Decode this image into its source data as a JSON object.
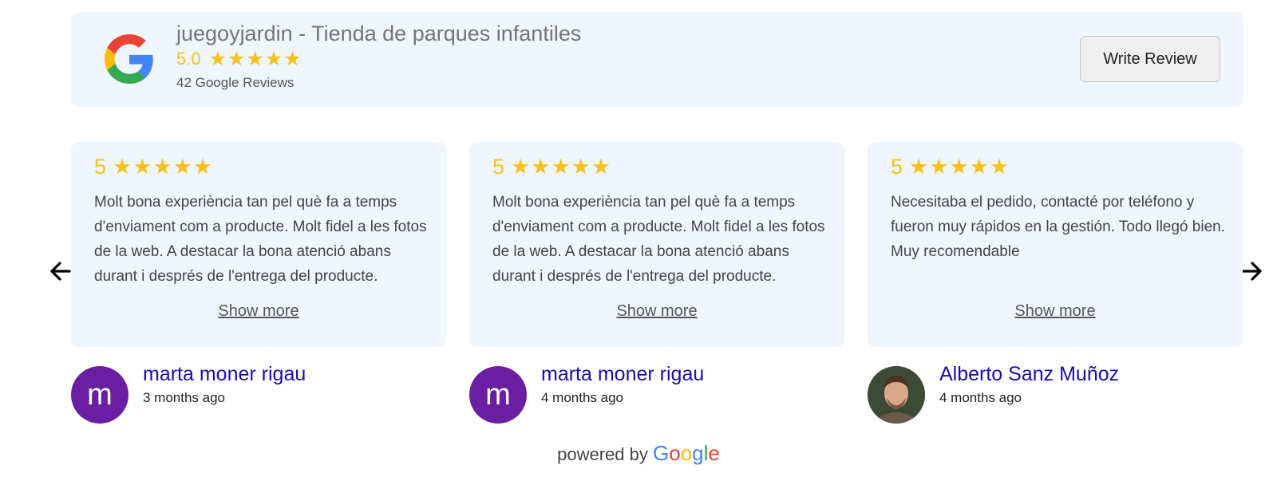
{
  "header": {
    "business_name": "juegoyjardin - Tienda de parques infantiles",
    "rating": "5.0",
    "stars": "★★★★★",
    "review_count": "42 Google Reviews",
    "write_review_label": "Write Review"
  },
  "reviews": [
    {
      "rating": "5",
      "stars": "★★★★★",
      "text": "Molt bona experiència tan pel què fa a temps d'enviament com a producte. Molt fidel a les fotos de la web. A destacar la bona atenció abans durant i després de l'entrega del producte.",
      "show_more": "Show more",
      "author": "marta moner rigau",
      "avatar_letter": "m",
      "date": "3 months ago"
    },
    {
      "rating": "5",
      "stars": "★★★★★",
      "text": "Molt bona experiència tan pel què fa a temps d'enviament com a producte. Molt fidel a les fotos de la web. A destacar la bona atenció abans durant i després de l'entrega del producte.",
      "show_more": "Show more",
      "author": "marta moner rigau",
      "avatar_letter": "m",
      "date": "4 months ago"
    },
    {
      "rating": "5",
      "stars": "★★★★★",
      "text": "Necesitaba el pedido, contacté por teléfono y fueron muy rápidos en la gestión. Todo llegó bien. Muy recomendable",
      "show_more": "Show more",
      "author": "Alberto Sanz Muñoz",
      "date": "4 months ago"
    }
  ],
  "footer": {
    "powered_by": "powered by",
    "google_letters": [
      "G",
      "o",
      "o",
      "g",
      "l",
      "e"
    ]
  },
  "colors": {
    "star": "#f3c21b",
    "card_bg": "#eff6fe",
    "author_link": "#1a0dab",
    "avatar_bg": "#6a1fa2"
  },
  "icons": [
    "google-g-icon",
    "arrow-left-icon",
    "arrow-right-icon"
  ]
}
